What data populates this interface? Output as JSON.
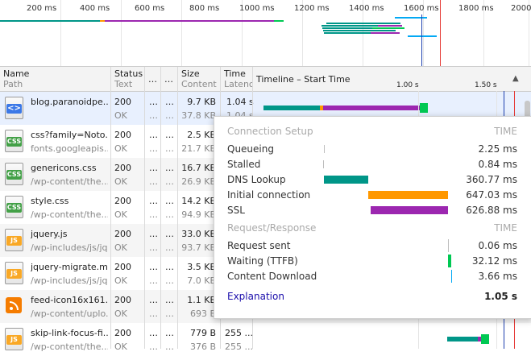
{
  "overview": {
    "ticks": [
      "200 ms",
      "400 ms",
      "600 ms",
      "800 ms",
      "1000 ms",
      "1200 ms",
      "1400 ms",
      "1600 ms",
      "1800 ms",
      "2000"
    ]
  },
  "columns": {
    "name": "Name",
    "path": "Path",
    "status": "Status",
    "text": "Text",
    "more1": "…",
    "more2": "…",
    "size": "Size",
    "content": "Content",
    "time": "Time",
    "latency": "Latenc",
    "timeline": "Timeline – Start Time",
    "t1": "1.00 s",
    "t2": "1.50 s",
    "sort_icon": "sort-up-icon"
  },
  "rows": [
    {
      "name": "blog.paranoidpe...",
      "path": "",
      "status": "200",
      "text": "OK",
      "c1": "…",
      "c2": "…",
      "size": "9.7 KB",
      "content": "37.8 KB",
      "time": "1.04 s",
      "latency": "1.04 s",
      "type": "html"
    },
    {
      "name": "css?family=Noto...",
      "path": "fonts.googleapis....",
      "status": "200",
      "text": "OK",
      "c1": "…",
      "c2": "…",
      "size": "2.5 KB",
      "content": "21.7 KB",
      "time": "",
      "latency": "",
      "type": "css"
    },
    {
      "name": "genericons.css",
      "path": "/wp-content/the...",
      "status": "200",
      "text": "OK",
      "c1": "…",
      "c2": "…",
      "size": "16.7 KB",
      "content": "26.9 KB",
      "time": "",
      "latency": "",
      "type": "css"
    },
    {
      "name": "style.css",
      "path": "/wp-content/the...",
      "status": "200",
      "text": "OK",
      "c1": "…",
      "c2": "…",
      "size": "14.2 KB",
      "content": "94.9 KB",
      "time": "",
      "latency": "",
      "type": "css"
    },
    {
      "name": "jquery.js",
      "path": "/wp-includes/js/jq...",
      "status": "200",
      "text": "OK",
      "c1": "…",
      "c2": "…",
      "size": "33.0 KB",
      "content": "93.7 KB",
      "time": "",
      "latency": "",
      "type": "js"
    },
    {
      "name": "jquery-migrate.m...",
      "path": "/wp-includes/js/jq...",
      "status": "200",
      "text": "OK",
      "c1": "…",
      "c2": "…",
      "size": "3.5 KB",
      "content": "7.0 KB",
      "time": "",
      "latency": "",
      "type": "js"
    },
    {
      "name": "feed-icon16x161...",
      "path": "/wp-content/uplo...",
      "status": "200",
      "text": "OK",
      "c1": "…",
      "c2": "…",
      "size": "1.1 KB",
      "content": "693 B",
      "time": "",
      "latency": "",
      "type": "img"
    },
    {
      "name": "skip-link-focus-fi...",
      "path": "/wp-content/the...",
      "status": "200",
      "text": "OK",
      "c1": "…",
      "c2": "…",
      "size": "779 B",
      "content": "376 B",
      "time": "255 ...",
      "latency": "255 ...",
      "type": "js"
    }
  ],
  "popover": {
    "setup_heading": "Connection Setup",
    "time_heading": "TIME",
    "setup": [
      {
        "label": "Queueing",
        "value": "2.25 ms",
        "color": "#bdbdbd"
      },
      {
        "label": "Stalled",
        "value": "0.84 ms",
        "color": "#bdbdbd"
      },
      {
        "label": "DNS Lookup",
        "value": "360.77 ms",
        "color": "#009688"
      },
      {
        "label": "Initial connection",
        "value": "647.03 ms",
        "color": "#ff9800"
      },
      {
        "label": "SSL",
        "value": "626.88 ms",
        "color": "#9c27b0"
      }
    ],
    "response_heading": "Request/Response",
    "response_time_heading": "TIME",
    "response": [
      {
        "label": "Request sent",
        "value": "0.06 ms",
        "color": "#bdbdbd"
      },
      {
        "label": "Waiting (TTFB)",
        "value": "32.12 ms",
        "color": "#00c853"
      },
      {
        "label": "Content Download",
        "value": "3.66 ms",
        "color": "#03a9f4"
      }
    ],
    "explanation": "Explanation",
    "total": "1.05 s"
  },
  "colors": {
    "dns": "#009688",
    "connect": "#ff9800",
    "ssl": "#9c27b0",
    "ttfb": "#00c853",
    "download": "#03a9f4",
    "dom_line": "#1e40af",
    "load_line": "#e53935"
  }
}
